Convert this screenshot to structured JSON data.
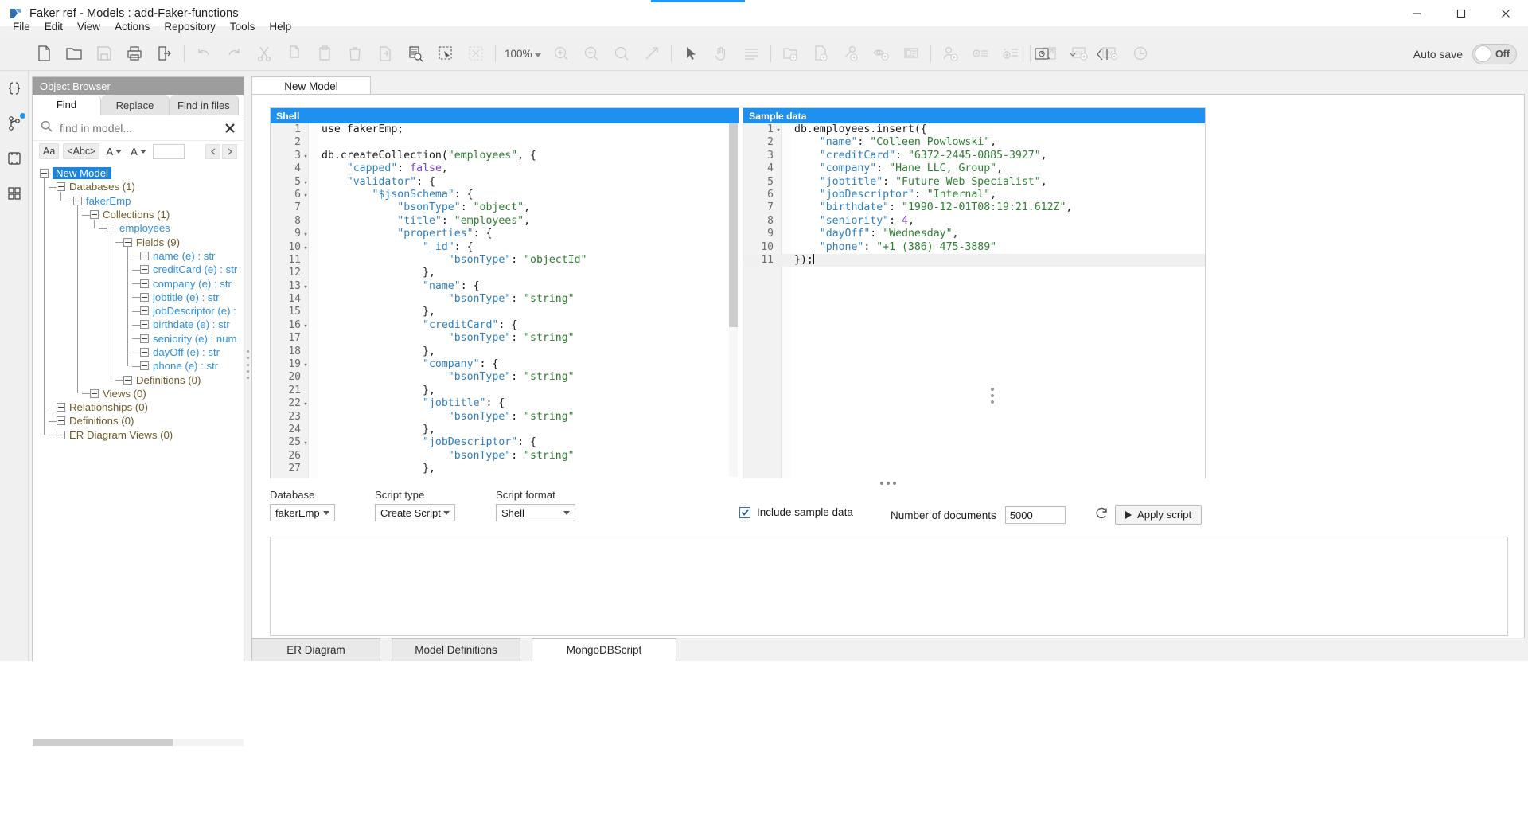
{
  "window": {
    "title": "Faker ref - Models : add-Faker-functions",
    "app_icon": "hackolade-logo-icon",
    "minimize": "minimize-icon",
    "maximize": "maximize-icon",
    "close": "close-icon"
  },
  "menu": {
    "items": [
      "File",
      "Edit",
      "View",
      "Actions",
      "Repository",
      "Tools",
      "Help"
    ]
  },
  "toolbar": {
    "zoom_level": "100%",
    "autosave_label": "Auto save",
    "autosave_state": "Off",
    "icons": [
      "new-document-icon",
      "open-folder-icon",
      "save-icon",
      "print-icon",
      "export-icon",
      "undo-icon",
      "redo-icon",
      "cut-icon",
      "copy-icon",
      "paste-icon",
      "delete-icon",
      "duplicate-icon",
      "find-in-document-icon",
      "select-region-icon",
      "fit-to-screen-icon",
      "zoom-in-icon",
      "zoom-out-icon",
      "zoom-reset-icon",
      "zoom-expand-icon",
      "pointer-icon",
      "pan-hand-icon",
      "align-lines-icon",
      "add-container-icon",
      "add-document-icon",
      "add-relationship-icon",
      "add-view-icon",
      "add-text-icon",
      "add-user-icon",
      "add-list-item-icon",
      "add-ordered-list-icon",
      "open-external-icon",
      "add-diagram-view-icon",
      "diagram-view-settings-icon",
      "clock-settings-icon",
      "collapse-panel-icon"
    ]
  },
  "rail": {
    "items": [
      {
        "name": "code-braces-icon",
        "badge": false
      },
      {
        "name": "git-branch-icon",
        "badge": true
      },
      {
        "name": "plugins-icon",
        "badge": false
      },
      {
        "name": "grid-apps-icon",
        "badge": false
      }
    ],
    "bottom": {
      "name": "settings-gear-icon"
    }
  },
  "object_browser": {
    "header": "Object Browser",
    "tabs": [
      {
        "label": "Find",
        "active": true
      },
      {
        "label": "Replace",
        "active": false
      },
      {
        "label": "Find in files",
        "active": false
      }
    ],
    "search": {
      "icon": "search-icon",
      "placeholder": "find in model...",
      "value": "",
      "clear_icon": "clear-x-icon"
    },
    "options": {
      "match_case": "Aa",
      "whole_word": "<Abc>",
      "scope_a": "A",
      "scope_b": "A",
      "extra_value": "",
      "prev": "prev-result-icon",
      "next": "next-result-icon"
    },
    "tree": [
      {
        "label": "New Model",
        "depth": 0,
        "style": "selected"
      },
      {
        "label": "Databases (1)",
        "depth": 1,
        "style": "group"
      },
      {
        "label": "fakerEmp",
        "depth": 2,
        "style": "blue"
      },
      {
        "label": "Collections (1)",
        "depth": 3,
        "style": "group"
      },
      {
        "label": "employees",
        "depth": 4,
        "style": "blue"
      },
      {
        "label": "Fields (9)",
        "depth": 5,
        "style": "group"
      },
      {
        "label": "name (e) : str",
        "depth": 6,
        "style": "blue"
      },
      {
        "label": "creditCard (e) : str",
        "depth": 6,
        "style": "blue"
      },
      {
        "label": "company (e) : str",
        "depth": 6,
        "style": "blue"
      },
      {
        "label": "jobtitle (e) : str",
        "depth": 6,
        "style": "blue"
      },
      {
        "label": "jobDescriptor (e) : ",
        "depth": 6,
        "style": "blue"
      },
      {
        "label": "birthdate (e) : str",
        "depth": 6,
        "style": "blue"
      },
      {
        "label": "seniority (e) : num",
        "depth": 6,
        "style": "blue"
      },
      {
        "label": "dayOff (e) : str",
        "depth": 6,
        "style": "blue"
      },
      {
        "label": "phone (e) : str",
        "depth": 6,
        "style": "blue"
      },
      {
        "label": "Definitions (0)",
        "depth": 5,
        "style": "group"
      },
      {
        "label": "Views (0)",
        "depth": 3,
        "style": "group"
      },
      {
        "label": "Relationships (0)",
        "depth": 1,
        "style": "group"
      },
      {
        "label": "Definitions (0)",
        "depth": 1,
        "style": "group"
      },
      {
        "label": "ER Diagram Views (0)",
        "depth": 1,
        "style": "group"
      }
    ]
  },
  "main_tab": {
    "label": "New Model"
  },
  "shell_pane": {
    "title": "Shell",
    "lines": [
      {
        "n": "1",
        "fold": false,
        "segs": [
          {
            "t": "use fakerEmp;",
            "c": "pl"
          }
        ]
      },
      {
        "n": "2",
        "fold": false,
        "segs": []
      },
      {
        "n": "3",
        "fold": true,
        "segs": [
          {
            "t": "db.createCollection(",
            "c": "pl"
          },
          {
            "t": "\"employees\"",
            "c": "str"
          },
          {
            "t": ", {",
            "c": "pl"
          }
        ]
      },
      {
        "n": "4",
        "fold": false,
        "segs": [
          {
            "t": "    ",
            "c": "pl"
          },
          {
            "t": "\"capped\"",
            "c": "key"
          },
          {
            "t": ": ",
            "c": "pl"
          },
          {
            "t": "false",
            "c": "lit"
          },
          {
            "t": ",",
            "c": "pl"
          }
        ]
      },
      {
        "n": "5",
        "fold": true,
        "segs": [
          {
            "t": "    ",
            "c": "pl"
          },
          {
            "t": "\"validator\"",
            "c": "key"
          },
          {
            "t": ": {",
            "c": "pl"
          }
        ]
      },
      {
        "n": "6",
        "fold": true,
        "segs": [
          {
            "t": "        ",
            "c": "pl"
          },
          {
            "t": "\"$jsonSchema\"",
            "c": "key"
          },
          {
            "t": ": {",
            "c": "pl"
          }
        ]
      },
      {
        "n": "7",
        "fold": false,
        "segs": [
          {
            "t": "            ",
            "c": "pl"
          },
          {
            "t": "\"bsonType\"",
            "c": "key"
          },
          {
            "t": ": ",
            "c": "pl"
          },
          {
            "t": "\"object\"",
            "c": "str"
          },
          {
            "t": ",",
            "c": "pl"
          }
        ]
      },
      {
        "n": "8",
        "fold": false,
        "segs": [
          {
            "t": "            ",
            "c": "pl"
          },
          {
            "t": "\"title\"",
            "c": "key"
          },
          {
            "t": ": ",
            "c": "pl"
          },
          {
            "t": "\"employees\"",
            "c": "str"
          },
          {
            "t": ",",
            "c": "pl"
          }
        ]
      },
      {
        "n": "9",
        "fold": true,
        "segs": [
          {
            "t": "            ",
            "c": "pl"
          },
          {
            "t": "\"properties\"",
            "c": "key"
          },
          {
            "t": ": {",
            "c": "pl"
          }
        ]
      },
      {
        "n": "10",
        "fold": true,
        "segs": [
          {
            "t": "                ",
            "c": "pl"
          },
          {
            "t": "\"_id\"",
            "c": "key"
          },
          {
            "t": ": {",
            "c": "pl"
          }
        ]
      },
      {
        "n": "11",
        "fold": false,
        "segs": [
          {
            "t": "                    ",
            "c": "pl"
          },
          {
            "t": "\"bsonType\"",
            "c": "key"
          },
          {
            "t": ": ",
            "c": "pl"
          },
          {
            "t": "\"objectId\"",
            "c": "str"
          }
        ]
      },
      {
        "n": "12",
        "fold": false,
        "segs": [
          {
            "t": "                },",
            "c": "pl"
          }
        ]
      },
      {
        "n": "13",
        "fold": true,
        "segs": [
          {
            "t": "                ",
            "c": "pl"
          },
          {
            "t": "\"name\"",
            "c": "key"
          },
          {
            "t": ": {",
            "c": "pl"
          }
        ]
      },
      {
        "n": "14",
        "fold": false,
        "segs": [
          {
            "t": "                    ",
            "c": "pl"
          },
          {
            "t": "\"bsonType\"",
            "c": "key"
          },
          {
            "t": ": ",
            "c": "pl"
          },
          {
            "t": "\"string\"",
            "c": "str"
          }
        ]
      },
      {
        "n": "15",
        "fold": false,
        "segs": [
          {
            "t": "                },",
            "c": "pl"
          }
        ]
      },
      {
        "n": "16",
        "fold": true,
        "segs": [
          {
            "t": "                ",
            "c": "pl"
          },
          {
            "t": "\"creditCard\"",
            "c": "key"
          },
          {
            "t": ": {",
            "c": "pl"
          }
        ]
      },
      {
        "n": "17",
        "fold": false,
        "segs": [
          {
            "t": "                    ",
            "c": "pl"
          },
          {
            "t": "\"bsonType\"",
            "c": "key"
          },
          {
            "t": ": ",
            "c": "pl"
          },
          {
            "t": "\"string\"",
            "c": "str"
          }
        ]
      },
      {
        "n": "18",
        "fold": false,
        "segs": [
          {
            "t": "                },",
            "c": "pl"
          }
        ]
      },
      {
        "n": "19",
        "fold": true,
        "segs": [
          {
            "t": "                ",
            "c": "pl"
          },
          {
            "t": "\"company\"",
            "c": "key"
          },
          {
            "t": ": {",
            "c": "pl"
          }
        ]
      },
      {
        "n": "20",
        "fold": false,
        "segs": [
          {
            "t": "                    ",
            "c": "pl"
          },
          {
            "t": "\"bsonType\"",
            "c": "key"
          },
          {
            "t": ": ",
            "c": "pl"
          },
          {
            "t": "\"string\"",
            "c": "str"
          }
        ]
      },
      {
        "n": "21",
        "fold": false,
        "segs": [
          {
            "t": "                },",
            "c": "pl"
          }
        ]
      },
      {
        "n": "22",
        "fold": true,
        "segs": [
          {
            "t": "                ",
            "c": "pl"
          },
          {
            "t": "\"jobtitle\"",
            "c": "key"
          },
          {
            "t": ": {",
            "c": "pl"
          }
        ]
      },
      {
        "n": "23",
        "fold": false,
        "segs": [
          {
            "t": "                    ",
            "c": "pl"
          },
          {
            "t": "\"bsonType\"",
            "c": "key"
          },
          {
            "t": ": ",
            "c": "pl"
          },
          {
            "t": "\"string\"",
            "c": "str"
          }
        ]
      },
      {
        "n": "24",
        "fold": false,
        "segs": [
          {
            "t": "                },",
            "c": "pl"
          }
        ]
      },
      {
        "n": "25",
        "fold": true,
        "segs": [
          {
            "t": "                ",
            "c": "pl"
          },
          {
            "t": "\"jobDescriptor\"",
            "c": "key"
          },
          {
            "t": ": {",
            "c": "pl"
          }
        ]
      },
      {
        "n": "26",
        "fold": false,
        "segs": [
          {
            "t": "                    ",
            "c": "pl"
          },
          {
            "t": "\"bsonType\"",
            "c": "key"
          },
          {
            "t": ": ",
            "c": "pl"
          },
          {
            "t": "\"string\"",
            "c": "str"
          }
        ]
      },
      {
        "n": "27",
        "fold": false,
        "segs": [
          {
            "t": "                },",
            "c": "pl"
          }
        ]
      }
    ]
  },
  "sample_pane": {
    "title": "Sample data",
    "lines": [
      {
        "n": "1",
        "fold": true,
        "segs": [
          {
            "t": "db.employees.insert({",
            "c": "pl"
          }
        ]
      },
      {
        "n": "2",
        "fold": false,
        "segs": [
          {
            "t": "    ",
            "c": "pl"
          },
          {
            "t": "\"name\"",
            "c": "key"
          },
          {
            "t": ": ",
            "c": "pl"
          },
          {
            "t": "\"Colleen Powlowski\"",
            "c": "str"
          },
          {
            "t": ",",
            "c": "pl"
          }
        ]
      },
      {
        "n": "3",
        "fold": false,
        "segs": [
          {
            "t": "    ",
            "c": "pl"
          },
          {
            "t": "\"creditCard\"",
            "c": "key"
          },
          {
            "t": ": ",
            "c": "pl"
          },
          {
            "t": "\"6372-2445-0885-3927\"",
            "c": "str"
          },
          {
            "t": ",",
            "c": "pl"
          }
        ]
      },
      {
        "n": "4",
        "fold": false,
        "segs": [
          {
            "t": "    ",
            "c": "pl"
          },
          {
            "t": "\"company\"",
            "c": "key"
          },
          {
            "t": ": ",
            "c": "pl"
          },
          {
            "t": "\"Hane LLC, Group\"",
            "c": "str"
          },
          {
            "t": ",",
            "c": "pl"
          }
        ]
      },
      {
        "n": "5",
        "fold": false,
        "segs": [
          {
            "t": "    ",
            "c": "pl"
          },
          {
            "t": "\"jobtitle\"",
            "c": "key"
          },
          {
            "t": ": ",
            "c": "pl"
          },
          {
            "t": "\"Future Web Specialist\"",
            "c": "str"
          },
          {
            "t": ",",
            "c": "pl"
          }
        ]
      },
      {
        "n": "6",
        "fold": false,
        "segs": [
          {
            "t": "    ",
            "c": "pl"
          },
          {
            "t": "\"jobDescriptor\"",
            "c": "key"
          },
          {
            "t": ": ",
            "c": "pl"
          },
          {
            "t": "\"Internal\"",
            "c": "str"
          },
          {
            "t": ",",
            "c": "pl"
          }
        ]
      },
      {
        "n": "7",
        "fold": false,
        "segs": [
          {
            "t": "    ",
            "c": "pl"
          },
          {
            "t": "\"birthdate\"",
            "c": "key"
          },
          {
            "t": ": ",
            "c": "pl"
          },
          {
            "t": "\"1990-12-01T08:19:21.612Z\"",
            "c": "str"
          },
          {
            "t": ",",
            "c": "pl"
          }
        ]
      },
      {
        "n": "8",
        "fold": false,
        "segs": [
          {
            "t": "    ",
            "c": "pl"
          },
          {
            "t": "\"seniority\"",
            "c": "key"
          },
          {
            "t": ": ",
            "c": "pl"
          },
          {
            "t": "4",
            "c": "num"
          },
          {
            "t": ",",
            "c": "pl"
          }
        ]
      },
      {
        "n": "9",
        "fold": false,
        "segs": [
          {
            "t": "    ",
            "c": "pl"
          },
          {
            "t": "\"dayOff\"",
            "c": "key"
          },
          {
            "t": ": ",
            "c": "pl"
          },
          {
            "t": "\"Wednesday\"",
            "c": "str"
          },
          {
            "t": ",",
            "c": "pl"
          }
        ]
      },
      {
        "n": "10",
        "fold": false,
        "segs": [
          {
            "t": "    ",
            "c": "pl"
          },
          {
            "t": "\"phone\"",
            "c": "key"
          },
          {
            "t": ": ",
            "c": "pl"
          },
          {
            "t": "\"+1 (386) 475-3889\"",
            "c": "str"
          }
        ]
      },
      {
        "n": "11",
        "fold": false,
        "cur": true,
        "segs": [
          {
            "t": "});",
            "c": "pl"
          }
        ]
      }
    ]
  },
  "controls": {
    "database": {
      "label": "Database",
      "value": "fakerEmp"
    },
    "script_type": {
      "label": "Script type",
      "value": "Create Script"
    },
    "script_format": {
      "label": "Script format",
      "value": "Shell"
    },
    "include_sample": {
      "label": "Include sample data",
      "checked": true
    },
    "number_of_documents": {
      "label": "Number of documents",
      "value": "5000"
    },
    "refresh_icon": "refresh-icon",
    "apply_button": {
      "label": "Apply script",
      "icon": "play-icon"
    }
  },
  "bottom_tabs": [
    {
      "label": "ER Diagram",
      "active": false
    },
    {
      "label": "Model Definitions",
      "active": false
    },
    {
      "label": "MongoDBScript",
      "active": true
    }
  ]
}
